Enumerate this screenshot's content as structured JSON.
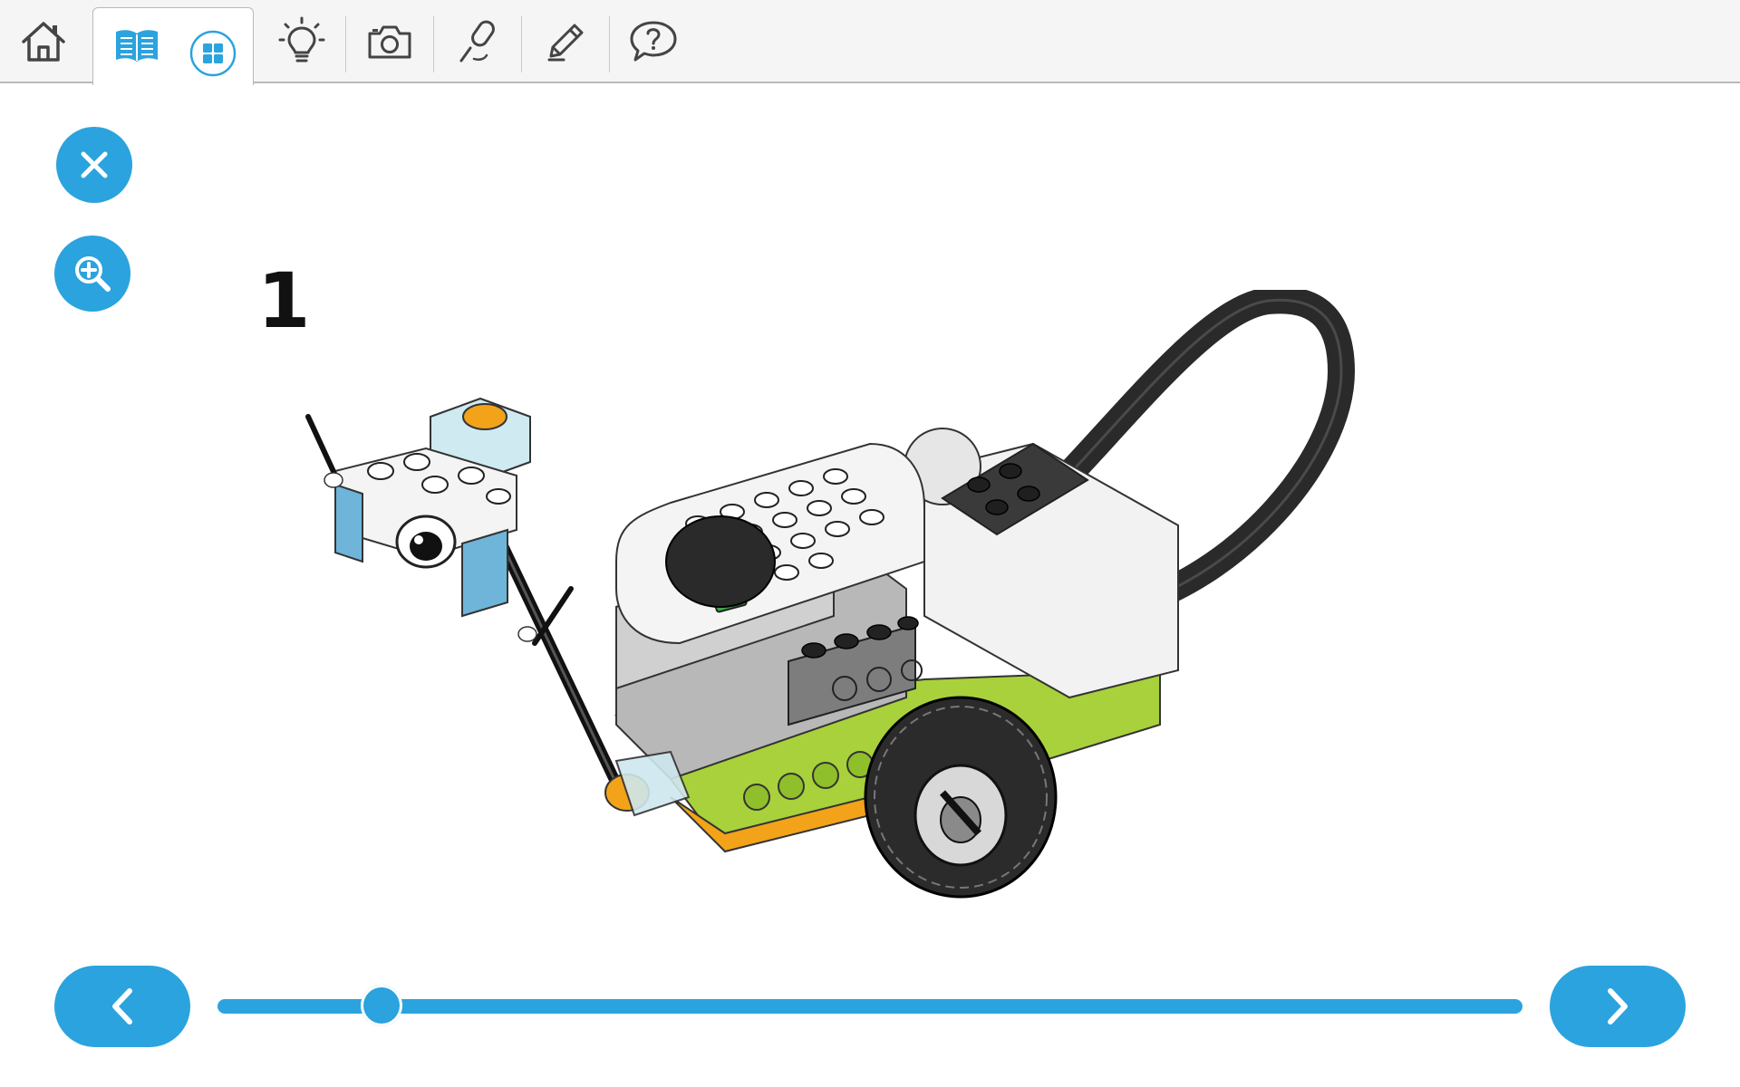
{
  "toolbar": {
    "items": [
      {
        "name": "home",
        "icon": "home-icon"
      },
      {
        "name": "instructions",
        "icon": "book-icon",
        "active": true
      },
      {
        "name": "gallery",
        "icon": "grid-icon",
        "active": true
      },
      {
        "name": "ideas",
        "icon": "lightbulb-icon"
      },
      {
        "name": "camera",
        "icon": "camera-icon"
      },
      {
        "name": "record",
        "icon": "microphone-icon"
      },
      {
        "name": "document",
        "icon": "pencil-icon"
      },
      {
        "name": "help",
        "icon": "question-bubble-icon"
      }
    ]
  },
  "side": {
    "close_icon": "close-icon",
    "zoom_icon": "zoom-in-icon"
  },
  "step": {
    "number": "1"
  },
  "navigation": {
    "prev_icon": "chevron-left-icon",
    "next_icon": "chevron-right-icon",
    "progress": 0.126
  },
  "colors": {
    "accent": "#2ba3de",
    "lime": "#a8d13b",
    "orange": "#f2a31a",
    "light_blue": "#6fb4d9",
    "green_button": "#3aa845"
  }
}
